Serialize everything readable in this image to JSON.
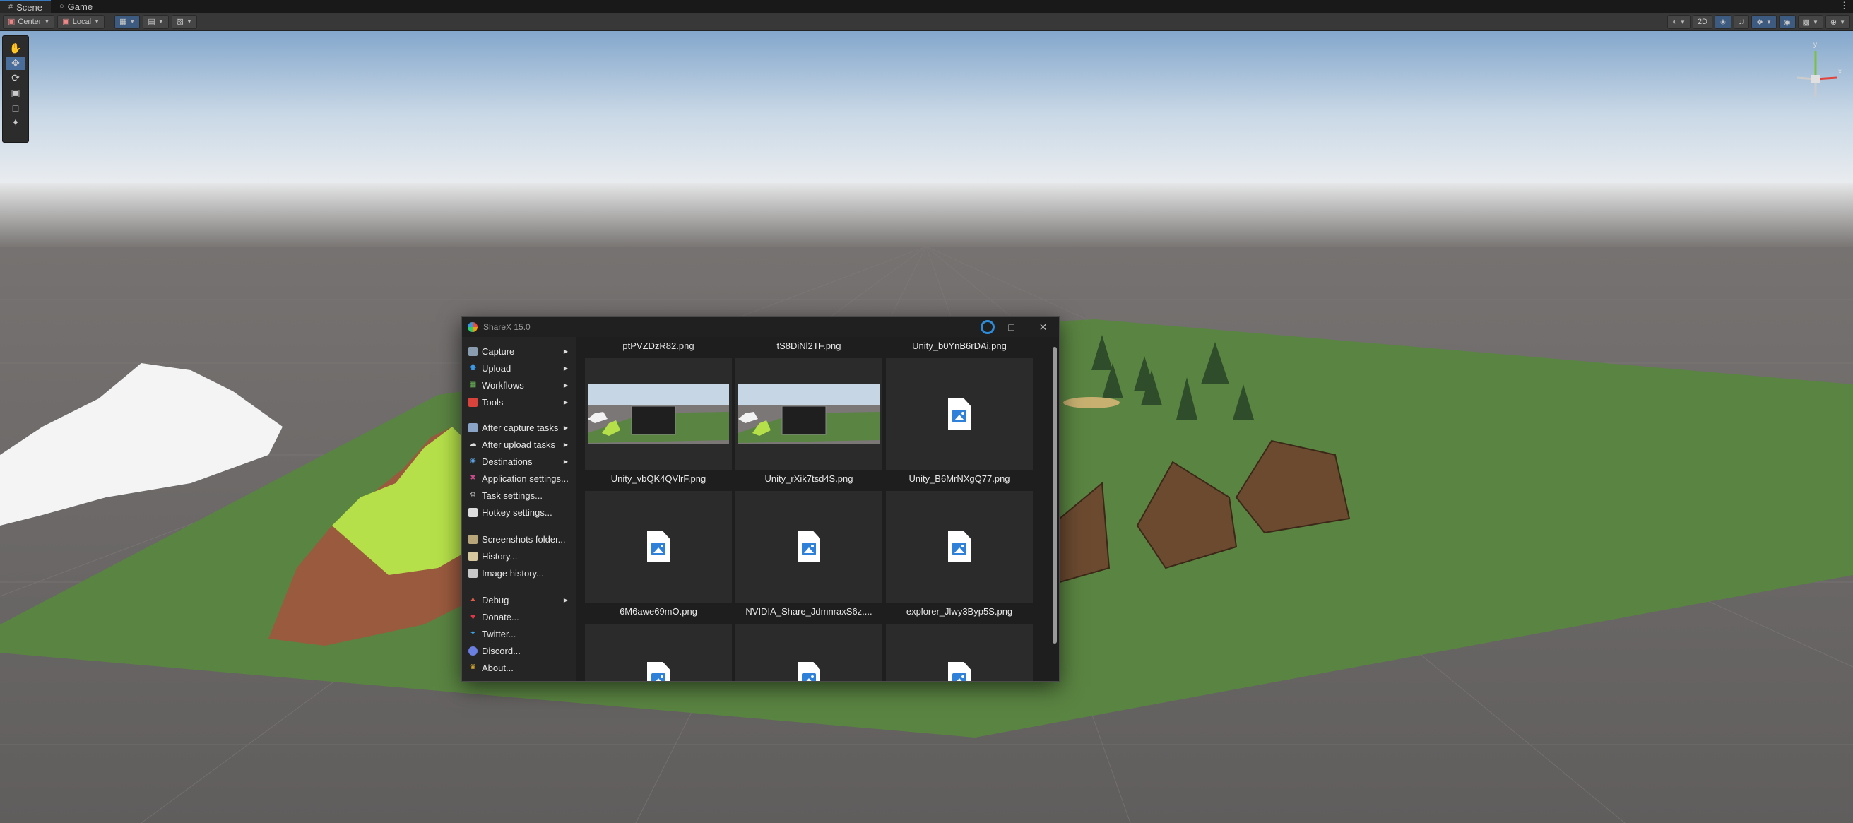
{
  "editor": {
    "tabs": [
      {
        "label": "Scene",
        "icon": "grid-icon"
      },
      {
        "label": "Game",
        "icon": "gamepad-icon"
      }
    ],
    "toolbar": {
      "pivot_label": "Center",
      "space_label": "Local",
      "toggle_2d_label": "2D"
    },
    "gizmo": {
      "y_label": "y",
      "x_label": "x"
    }
  },
  "sharex": {
    "title": "ShareX 15.0",
    "menu": [
      {
        "label": "Capture",
        "icon": "capture-icon",
        "submenu": true
      },
      {
        "label": "Upload",
        "icon": "upload-icon",
        "submenu": true
      },
      {
        "label": "Workflows",
        "icon": "workflows-icon",
        "submenu": true
      },
      {
        "label": "Tools",
        "icon": "tools-icon",
        "submenu": true
      },
      {
        "label": "After capture tasks",
        "icon": "after-capture-icon",
        "submenu": true
      },
      {
        "label": "After upload tasks",
        "icon": "after-upload-icon",
        "submenu": true
      },
      {
        "label": "Destinations",
        "icon": "destinations-icon",
        "submenu": true
      },
      {
        "label": "Application settings...",
        "icon": "app-settings-icon",
        "submenu": false
      },
      {
        "label": "Task settings...",
        "icon": "task-settings-icon",
        "submenu": false
      },
      {
        "label": "Hotkey settings...",
        "icon": "hotkey-icon",
        "submenu": false
      },
      {
        "label": "Screenshots folder...",
        "icon": "folder-icon",
        "submenu": false
      },
      {
        "label": "History...",
        "icon": "history-icon",
        "submenu": false
      },
      {
        "label": "Image history...",
        "icon": "image-history-icon",
        "submenu": false
      },
      {
        "label": "Debug",
        "icon": "debug-icon",
        "submenu": true
      },
      {
        "label": "Donate...",
        "icon": "heart-icon",
        "submenu": false
      },
      {
        "label": "Twitter...",
        "icon": "twitter-icon",
        "submenu": false
      },
      {
        "label": "Discord...",
        "icon": "discord-icon",
        "submenu": false
      },
      {
        "label": "About...",
        "icon": "crown-icon",
        "submenu": false
      }
    ],
    "files": [
      {
        "name": "ptPVZDzR82.png",
        "thumb": "screenshot"
      },
      {
        "name": "tS8DiNl2TF.png",
        "thumb": "screenshot"
      },
      {
        "name": "Unity_b0YnB6rDAi.png",
        "thumb": "file-icon"
      },
      {
        "name": "Unity_vbQK4QVlrF.png",
        "thumb": "file-icon"
      },
      {
        "name": "Unity_rXik7tsd4S.png",
        "thumb": "file-icon"
      },
      {
        "name": "Unity_B6MrNXgQ77.png",
        "thumb": "file-icon"
      },
      {
        "name": "6M6awe69mO.png",
        "thumb": "file-icon"
      },
      {
        "name": "NVIDIA_Share_JdmnraxS6z....",
        "thumb": "file-icon"
      },
      {
        "name": "explorer_Jlwy3Byp5S.png",
        "thumb": "file-icon"
      }
    ]
  },
  "colors": {
    "accent": "#3a79bb",
    "ground": "#5a8442",
    "sky_top": "#8fb0d0",
    "floor": "#6b6968"
  }
}
